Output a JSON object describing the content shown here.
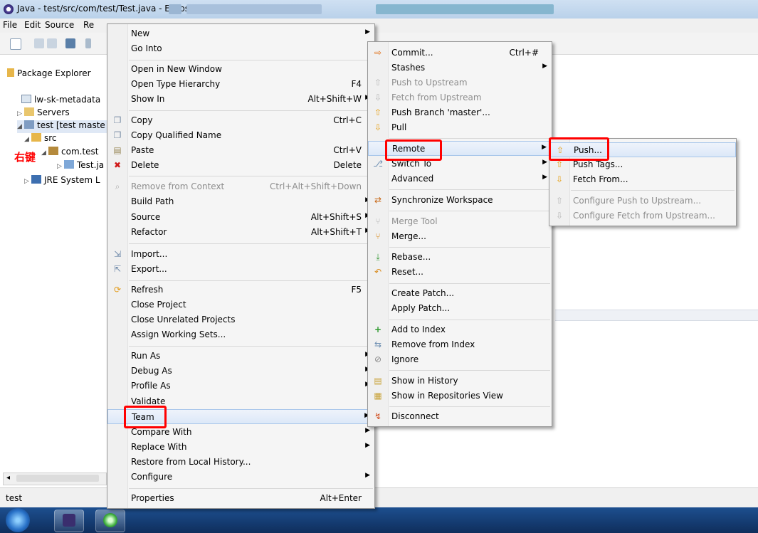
{
  "window": {
    "title": "Java - test/src/com/test/Test.java - Eclipse"
  },
  "menubar": {
    "file": "File",
    "edit": "Edit",
    "source": "Source",
    "refactor": "Re"
  },
  "explorer": {
    "tab_label": "Package Explorer",
    "items": [
      {
        "label": "lw-sk-metadata"
      },
      {
        "label": "Servers"
      },
      {
        "label": "test  [test maste"
      },
      {
        "label": "src"
      },
      {
        "label": "com.test"
      },
      {
        "label": "Test.ja"
      },
      {
        "label": "JRE System L"
      }
    ],
    "annotation": "右键"
  },
  "context_menu": {
    "items": [
      {
        "label": "New",
        "accel": ""
      },
      {
        "label": "Go Into",
        "accel": ""
      },
      {
        "label": "Open in New Window",
        "accel": ""
      },
      {
        "label": "Open Type Hierarchy",
        "accel": "F4"
      },
      {
        "label": "Show In",
        "accel": "Alt+Shift+W"
      },
      {
        "label": "Copy",
        "accel": "Ctrl+C"
      },
      {
        "label": "Copy Qualified Name",
        "accel": ""
      },
      {
        "label": "Paste",
        "accel": "Ctrl+V"
      },
      {
        "label": "Delete",
        "accel": "Delete"
      },
      {
        "label": "Remove from Context",
        "accel": "Ctrl+Alt+Shift+Down"
      },
      {
        "label": "Build Path",
        "accel": ""
      },
      {
        "label": "Source",
        "accel": "Alt+Shift+S"
      },
      {
        "label": "Refactor",
        "accel": "Alt+Shift+T"
      },
      {
        "label": "Import...",
        "accel": ""
      },
      {
        "label": "Export...",
        "accel": ""
      },
      {
        "label": "Refresh",
        "accel": "F5"
      },
      {
        "label": "Close Project",
        "accel": ""
      },
      {
        "label": "Close Unrelated Projects",
        "accel": ""
      },
      {
        "label": "Assign Working Sets...",
        "accel": ""
      },
      {
        "label": "Run As",
        "accel": ""
      },
      {
        "label": "Debug As",
        "accel": ""
      },
      {
        "label": "Profile As",
        "accel": ""
      },
      {
        "label": "Validate",
        "accel": ""
      },
      {
        "label": "Team",
        "accel": ""
      },
      {
        "label": "Compare With",
        "accel": ""
      },
      {
        "label": "Replace With",
        "accel": ""
      },
      {
        "label": "Restore from Local History...",
        "accel": ""
      },
      {
        "label": "Configure",
        "accel": ""
      },
      {
        "label": "Properties",
        "accel": "Alt+Enter"
      }
    ]
  },
  "team_menu": {
    "items": [
      {
        "label": "Commit...",
        "accel": "Ctrl+#"
      },
      {
        "label": "Stashes",
        "accel": ""
      },
      {
        "label": "Push to Upstream",
        "accel": ""
      },
      {
        "label": "Fetch from Upstream",
        "accel": ""
      },
      {
        "label": "Push Branch 'master'...",
        "accel": ""
      },
      {
        "label": "Pull",
        "accel": ""
      },
      {
        "label": "Remote",
        "accel": ""
      },
      {
        "label": "Switch To",
        "accel": ""
      },
      {
        "label": "Advanced",
        "accel": ""
      },
      {
        "label": "Synchronize Workspace",
        "accel": ""
      },
      {
        "label": "Merge Tool",
        "accel": ""
      },
      {
        "label": "Merge...",
        "accel": ""
      },
      {
        "label": "Rebase...",
        "accel": ""
      },
      {
        "label": "Reset...",
        "accel": ""
      },
      {
        "label": "Create Patch...",
        "accel": ""
      },
      {
        "label": "Apply Patch...",
        "accel": ""
      },
      {
        "label": "Add to Index",
        "accel": ""
      },
      {
        "label": "Remove from Index",
        "accel": ""
      },
      {
        "label": "Ignore",
        "accel": ""
      },
      {
        "label": "Show in History",
        "accel": ""
      },
      {
        "label": "Show in Repositories View",
        "accel": ""
      },
      {
        "label": "Disconnect",
        "accel": ""
      }
    ]
  },
  "remote_menu": {
    "items": [
      {
        "label": "Push..."
      },
      {
        "label": "Push Tags..."
      },
      {
        "label": "Fetch From..."
      },
      {
        "label": "Configure Push to Upstream..."
      },
      {
        "label": "Configure Fetch from Upstream..."
      }
    ]
  },
  "statusbar": {
    "text": "test"
  },
  "colors": {
    "highlight_box": "#ff0000",
    "annotation": "#ff0000",
    "menu_bg": "#f5f5f5"
  }
}
